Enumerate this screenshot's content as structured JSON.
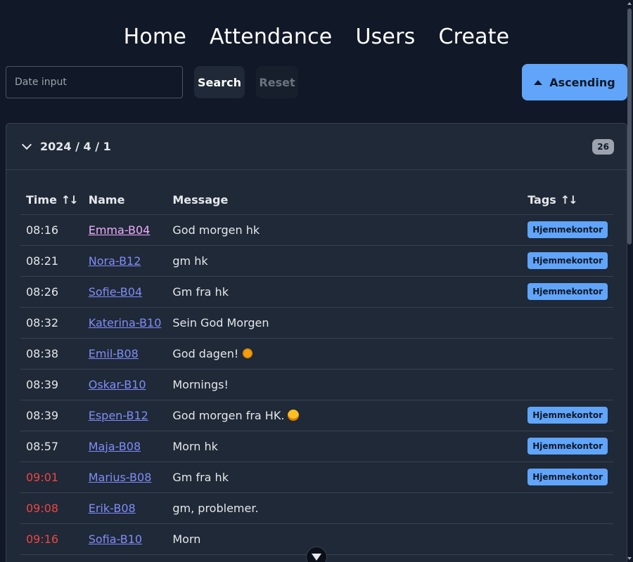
{
  "nav": {
    "items": [
      {
        "label": "Home"
      },
      {
        "label": "Attendance"
      },
      {
        "label": "Users"
      },
      {
        "label": "Create"
      }
    ]
  },
  "controls": {
    "date_placeholder": "Date input",
    "search_label": "Search",
    "reset_label": "Reset",
    "sort_label": "Ascending",
    "sort_icon": "triangle-up-icon"
  },
  "group": {
    "date": "2024 / 4 / 1",
    "count": "26",
    "columns": {
      "time": "Time",
      "name": "Name",
      "message": "Message",
      "tags": "Tags"
    },
    "sort_glyph": "↑↓",
    "rows": [
      {
        "time": "08:16",
        "name": "Emma-B04",
        "message": "God morgen hk",
        "tag": "Hjemmekontor"
      },
      {
        "time": "08:21",
        "name": "Nora-B12",
        "message": "gm hk",
        "tag": "Hjemmekontor"
      },
      {
        "time": "08:26",
        "name": "Sofie-B04",
        "message": "Gm fra hk",
        "tag": "Hjemmekontor"
      },
      {
        "time": "08:32",
        "name": "Katerina-B10",
        "message": "Sein God Morgen",
        "tag": ""
      },
      {
        "time": "08:38",
        "name": "Emil-B08",
        "message": "God dagen!",
        "tag": ""
      },
      {
        "time": "08:39",
        "name": "Oskar-B10",
        "message": "Mornings!",
        "tag": ""
      },
      {
        "time": "08:39",
        "name": "Espen-B12",
        "message": "God morgen fra HK.",
        "tag": "Hjemmekontor"
      },
      {
        "time": "08:57",
        "name": "Maja-B08",
        "message": "Morn hk",
        "tag": "Hjemmekontor"
      },
      {
        "time": "09:01",
        "name": "Marius-B08",
        "message": "Gm fra hk",
        "tag": "Hjemmekontor"
      },
      {
        "time": "09:08",
        "name": "Erik-B08",
        "message": "gm, problemer.",
        "tag": ""
      },
      {
        "time": "09:16",
        "name": "Sofia-B10",
        "message": "Morn",
        "tag": ""
      }
    ]
  },
  "colors": {
    "background": "#111827",
    "card": "#1f2937",
    "accent": "#60a5fa",
    "late": "#ef4444",
    "link": "#818cf8"
  }
}
